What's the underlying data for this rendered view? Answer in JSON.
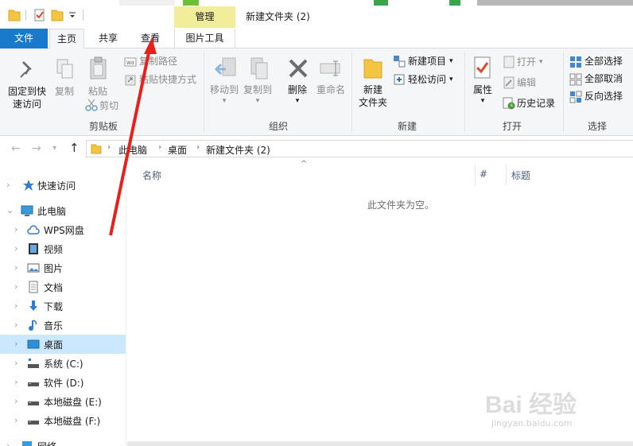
{
  "window": {
    "title": "新建文件夹 (2)",
    "context_tab": "管理"
  },
  "tabs": {
    "file": "文件",
    "home": "主页",
    "share": "共享",
    "view": "查看",
    "picture_tools": "图片工具"
  },
  "ribbon": {
    "clipboard": {
      "group_label": "剪贴板",
      "pin_label_1": "固定到快",
      "pin_label_2": "速访问",
      "copy": "复制",
      "paste": "粘贴",
      "copy_path": "复制路径",
      "paste_shortcut": "粘贴快捷方式",
      "cut": "剪切"
    },
    "organize": {
      "group_label": "组织",
      "move_to": "移动到",
      "copy_to": "复制到",
      "delete": "删除",
      "rename": "重命名"
    },
    "new": {
      "group_label": "新建",
      "new_folder_1": "新建",
      "new_folder_2": "文件夹",
      "new_item": "新建项目",
      "easy_access": "轻松访问"
    },
    "open": {
      "group_label": "打开",
      "properties": "属性",
      "open": "打开",
      "edit": "编辑",
      "history": "历史记录"
    },
    "select": {
      "group_label": "选择",
      "select_all": "全部选择",
      "select_none": "全部取消",
      "invert": "反向选择"
    }
  },
  "address": {
    "crumbs": [
      "此电脑",
      "桌面",
      "新建文件夹 (2)"
    ]
  },
  "nav": {
    "items": [
      {
        "label": "快速访问"
      },
      {
        "label": "此电脑"
      },
      {
        "label": "WPS网盘"
      },
      {
        "label": "视频"
      },
      {
        "label": "图片"
      },
      {
        "label": "文档"
      },
      {
        "label": "下载"
      },
      {
        "label": "音乐"
      },
      {
        "label": "桌面"
      },
      {
        "label": "系统 (C:)"
      },
      {
        "label": "软件 (D:)"
      },
      {
        "label": "本地磁盘 (E:)"
      },
      {
        "label": "本地磁盘 (F:)"
      },
      {
        "label": "网络"
      }
    ]
  },
  "content": {
    "columns": {
      "name": "名称",
      "number": "#",
      "title": "标题"
    },
    "empty_message": "此文件夹为空。"
  },
  "watermark": {
    "brand": "Bai 经验",
    "url": "jingyan.baidu.com"
  },
  "colors": {
    "file_tab": "#1979ca",
    "context_tab": "#f1ed9a",
    "selected_nav": "#cce8ff",
    "annotation_arrow": "#e8201c"
  }
}
